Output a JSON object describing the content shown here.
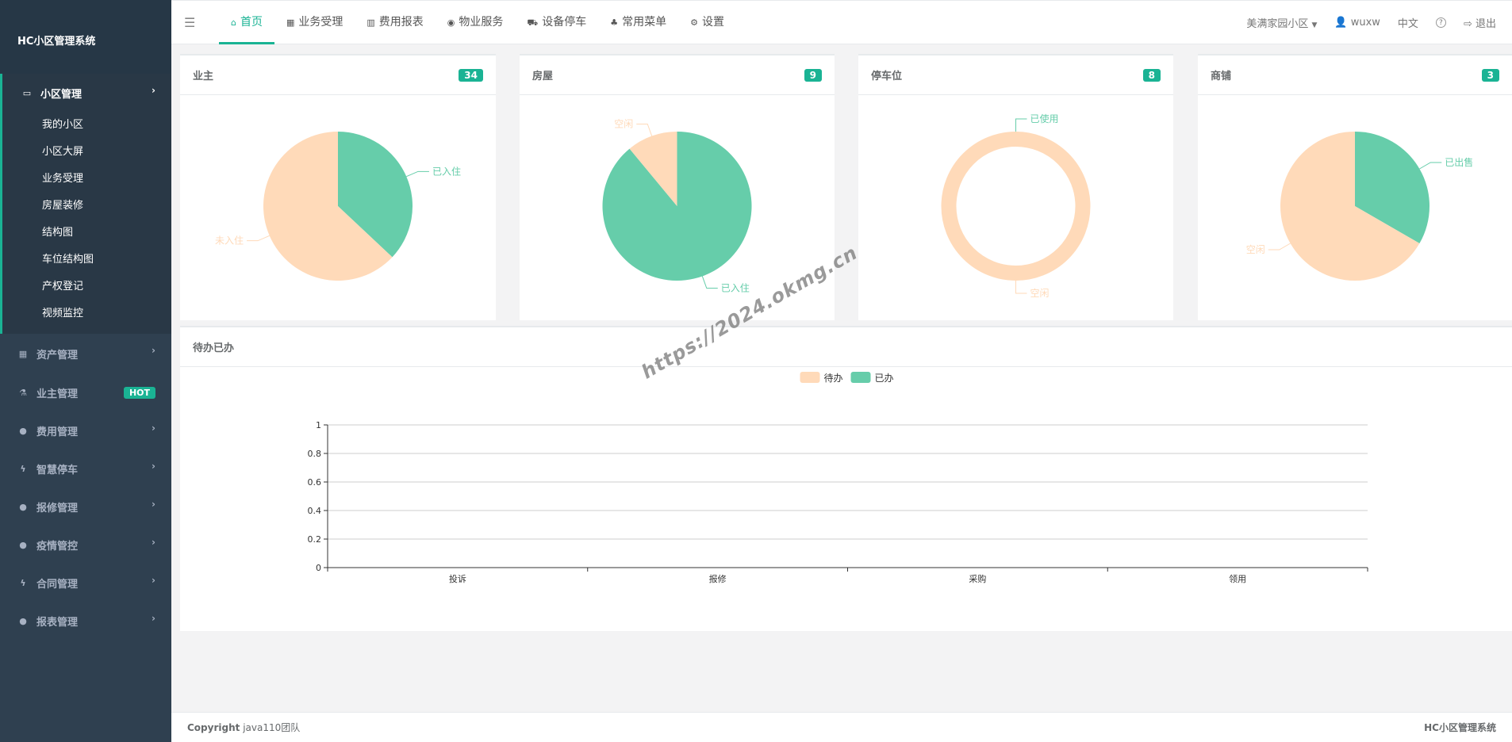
{
  "sidebar": {
    "brand": "HC小区管理系统",
    "active_group": {
      "label": "小区管理",
      "items": [
        "我的小区",
        "小区大屏",
        "业务受理",
        "房屋装修",
        "结构图",
        "车位结构图",
        "产权登记",
        "视频监控"
      ]
    },
    "groups": [
      {
        "label": "资产管理",
        "icon": "grid-icon"
      },
      {
        "label": "业主管理",
        "icon": "flask-icon",
        "badge": "HOT"
      },
      {
        "label": "费用管理",
        "icon": "globe-icon"
      },
      {
        "label": "智慧停车",
        "icon": "bolt-icon"
      },
      {
        "label": "报修管理",
        "icon": "globe-icon"
      },
      {
        "label": "疫情管控",
        "icon": "globe-icon"
      },
      {
        "label": "合同管理",
        "icon": "bolt-icon"
      },
      {
        "label": "报表管理",
        "icon": "globe-icon"
      }
    ]
  },
  "topnav": {
    "items": [
      "首页",
      "业务受理",
      "费用报表",
      "物业服务",
      "设备停车",
      "常用菜单",
      "设置"
    ],
    "community": "美满家园小区",
    "user": "wuxw",
    "lang": "中文",
    "logout": "退出"
  },
  "cards": [
    {
      "title": "业主",
      "count": "34",
      "donut": false,
      "slices": [
        {
          "label": "已入住",
          "value": 37,
          "color": "#66cdaa"
        },
        {
          "label": "未入住",
          "value": 63,
          "color": "#ffdab9"
        }
      ]
    },
    {
      "title": "房屋",
      "count": "9",
      "donut": false,
      "slices": [
        {
          "label": "已入住",
          "value": 89,
          "color": "#66cdaa"
        },
        {
          "label": "空闲",
          "value": 11,
          "color": "#ffdab9"
        }
      ]
    },
    {
      "title": "停车位",
      "count": "8",
      "donut": true,
      "slices": [
        {
          "label": "已使用",
          "value": 0,
          "color": "#66cdaa"
        },
        {
          "label": "空闲",
          "value": 8,
          "color": "#ffdab9"
        }
      ]
    },
    {
      "title": "商铺",
      "count": "3",
      "donut": false,
      "slices": [
        {
          "label": "已出售",
          "value": 1,
          "color": "#66cdaa"
        },
        {
          "label": "空闲",
          "value": 2,
          "color": "#ffdab9"
        }
      ]
    }
  ],
  "chart_data": {
    "type": "bar",
    "title": "待办已办",
    "categories": [
      "投诉",
      "报修",
      "采购",
      "领用"
    ],
    "series": [
      {
        "name": "待办",
        "values": [
          0,
          0,
          0,
          0
        ],
        "color": "#ffdab9"
      },
      {
        "name": "已办",
        "values": [
          0,
          0,
          0,
          0
        ],
        "color": "#66cdaa"
      }
    ],
    "ylim": [
      0,
      1
    ],
    "yticks": [
      "0",
      "0.2",
      "0.4",
      "0.6",
      "0.8",
      "1"
    ],
    "legend": "top-center",
    "grid": true
  },
  "footer": {
    "copyright_label": "Copyright",
    "team": "java110团队",
    "brand": "HC小区管理系统"
  },
  "watermark": "https://2024.okmg.cn"
}
